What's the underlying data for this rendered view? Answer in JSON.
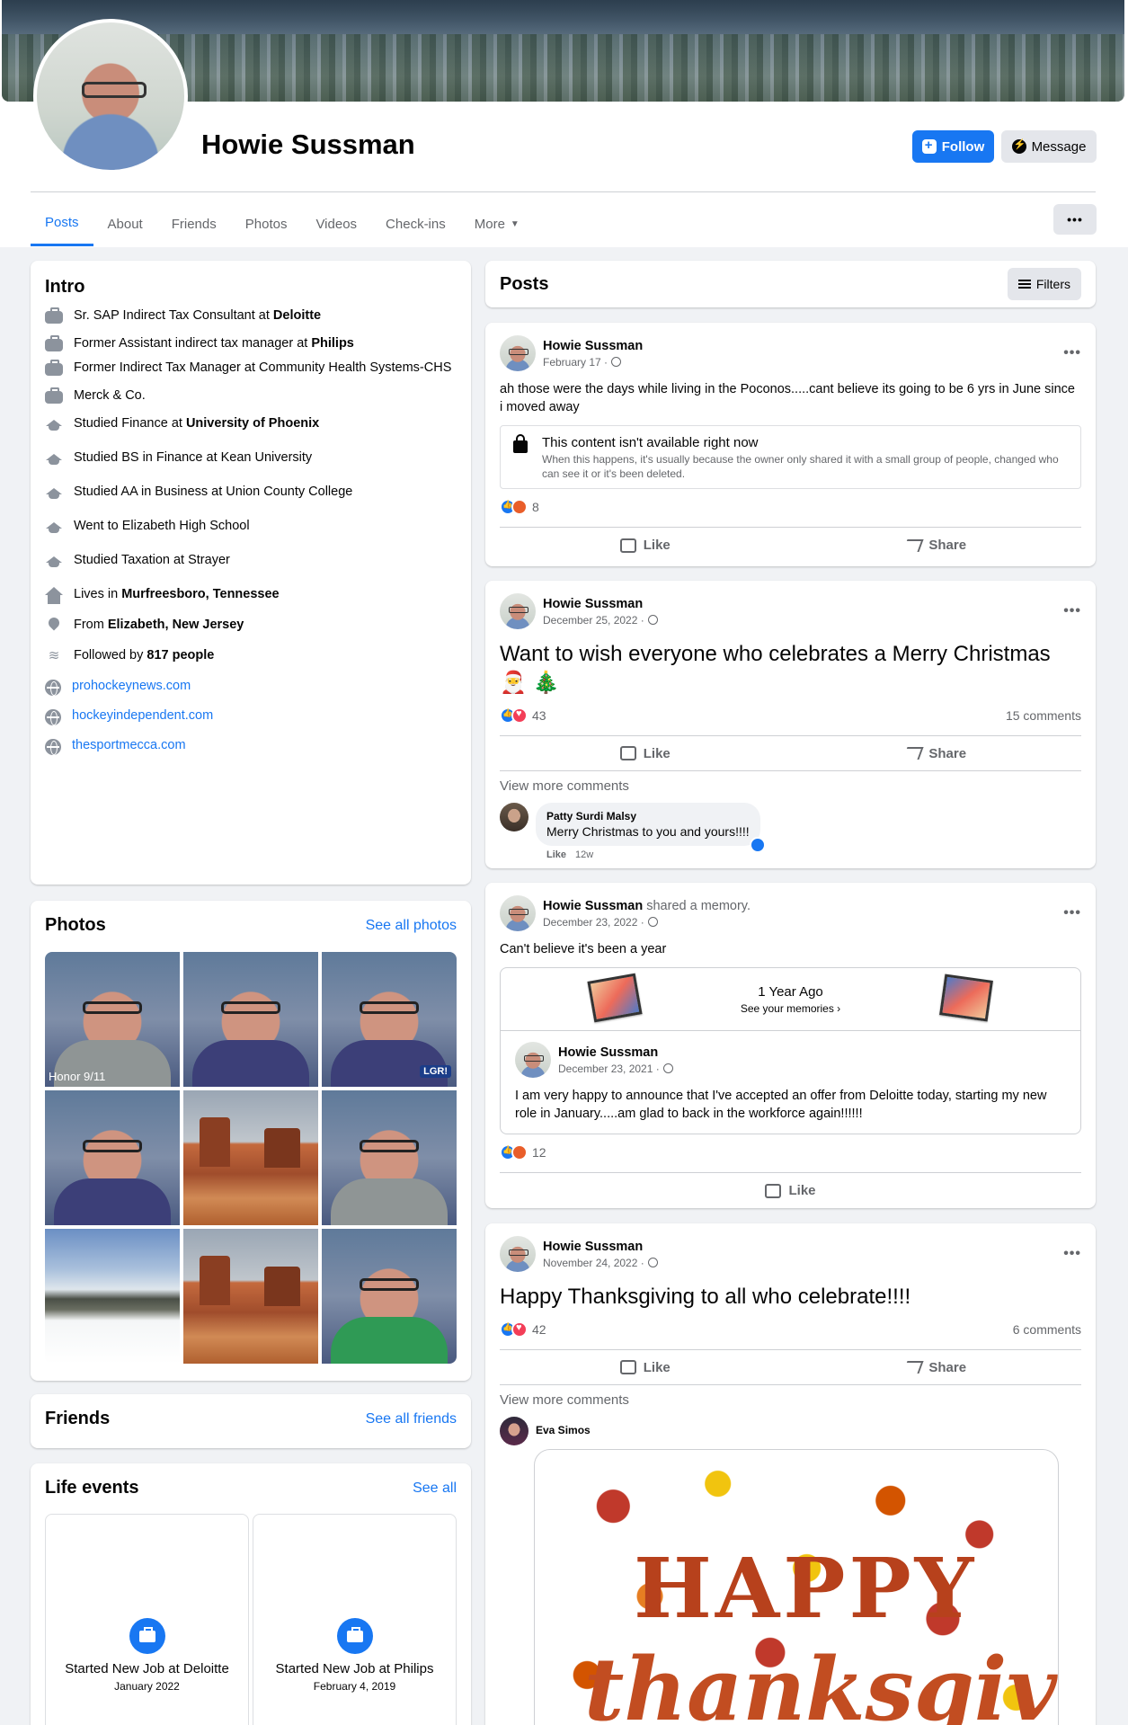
{
  "profile": {
    "name": "Howie Sussman",
    "follow_label": "Follow",
    "message_label": "Message"
  },
  "tabs": [
    {
      "label": "Posts"
    },
    {
      "label": "About"
    },
    {
      "label": "Friends"
    },
    {
      "label": "Photos"
    },
    {
      "label": "Videos"
    },
    {
      "label": "Check-ins"
    },
    {
      "label": "More"
    }
  ],
  "tab_more_dots": "•••",
  "intro": {
    "title": "Intro",
    "items": [
      {
        "pre": "Sr. SAP Indirect Tax Consultant at ",
        "bold": "Deloitte"
      },
      {
        "pre": "Former Assistant indirect tax manager at ",
        "bold": "Philips"
      },
      {
        "pre": "Former Indirect Tax Manager at Community Health Systems-CHS",
        "bold": ""
      },
      {
        "pre": "Merck & Co.",
        "bold": ""
      },
      {
        "pre": "Studied Finance at ",
        "bold": "University of Phoenix"
      },
      {
        "pre": "Studied BS in Finance at Kean University",
        "bold": ""
      },
      {
        "pre": "Studied AA in Business at Union County College",
        "bold": ""
      },
      {
        "pre": "Went to Elizabeth High School",
        "bold": ""
      },
      {
        "pre": "Studied Taxation at Strayer",
        "bold": ""
      },
      {
        "pre": "Lives in ",
        "bold": "Murfreesboro, Tennessee"
      },
      {
        "pre": "From ",
        "bold": "Elizabeth, New Jersey"
      },
      {
        "pre": "Followed by ",
        "bold": "817 people"
      },
      {
        "pre": "prohockeynews.com",
        "bold": ""
      },
      {
        "pre": "hockeyindependent.com",
        "bold": ""
      },
      {
        "pre": "thesportmecca.com",
        "bold": ""
      }
    ]
  },
  "photos": {
    "title": "Photos",
    "see_all": "See all photos",
    "tag_honor": "Honor 9/11",
    "tag_lgr": "LGR!"
  },
  "friends": {
    "title": "Friends",
    "see_all": "See all friends"
  },
  "life_events": {
    "title": "Life events",
    "see_all": "See all",
    "items": [
      {
        "title": "Started New Job at Deloitte",
        "date": "January 2022"
      },
      {
        "title": "Started New Job at Philips",
        "date": "February 4, 2019"
      }
    ]
  },
  "posts_header": {
    "title": "Posts",
    "filters_label": "Filters"
  },
  "posts": [
    {
      "author": "Howie Sussman",
      "date": "February 17 ·",
      "text": "ah those were the days while living in the Poconos.....cant believe its going to be 6 yrs in June since i moved away",
      "locked_title": "This content isn't available right now",
      "locked_text": "When this happens, it's usually because the owner only shared it with a small group of people, changed who can see it or it's been deleted.",
      "reaction_count": "8",
      "like_label": "Like",
      "share_label": "Share"
    },
    {
      "author": "Howie Sussman",
      "date": "December 25, 2022 ·",
      "text": "Want to wish everyone who celebrates a Merry Christmas 🎅 🎄",
      "reaction_count": "43",
      "comments_count": "15 comments",
      "like_label": "Like",
      "share_label": "Share",
      "view_more": "View more comments",
      "comment_name": "Patty Surdi Malsy",
      "comment_text": "Merry Christmas to you and yours!!!!",
      "comment_like": "Like",
      "comment_time": "12w"
    },
    {
      "author": "Howie Sussman",
      "shared_text": " shared a memory.",
      "date": "December 23, 2022 ·",
      "text": "Can't believe it's been a year",
      "memory_title": "1 Year Ago",
      "memory_sub": "See your memories ›",
      "inner_author": "Howie Sussman",
      "inner_date": "December 23, 2021 ·",
      "inner_text": "I am very happy to announce that I've accepted an offer from Deloitte today, starting my new role in January.....am glad to back in the workforce again!!!!!!",
      "reaction_count": "12",
      "like_label": "Like"
    },
    {
      "author": "Howie Sussman",
      "date": "November 24, 2022 ·",
      "text": "Happy Thanksgiving to all who celebrate!!!!",
      "reaction_count": "42",
      "comments_count": "6 comments",
      "like_label": "Like",
      "share_label": "Share",
      "view_more": "View more comments",
      "comment_name": "Eva Simos",
      "image_text_1": "HAPPY",
      "image_text_2": "thanksgiving"
    }
  ],
  "more_dots": "•••"
}
